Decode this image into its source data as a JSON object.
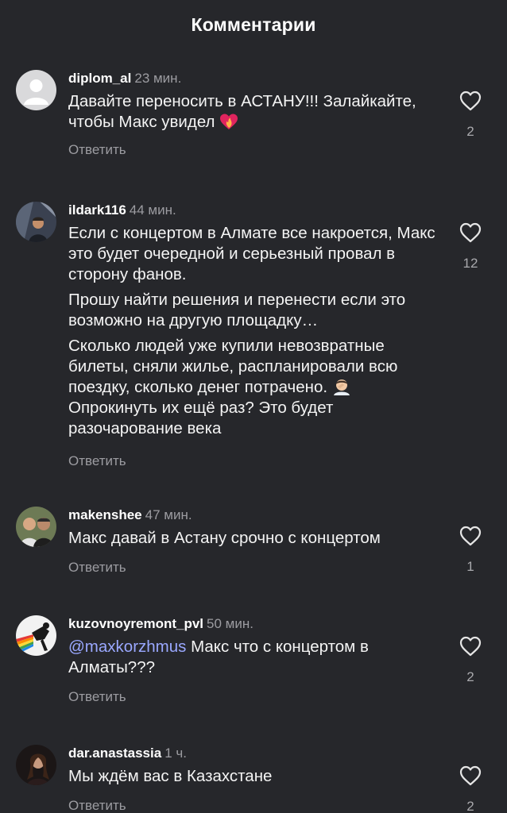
{
  "header": {
    "title": "Комментарии"
  },
  "colors": {
    "background": "#26272b",
    "text": "#f2f2f2",
    "muted": "#9c9ca1",
    "mention": "#9aa8ff"
  },
  "comments": [
    {
      "username": "diplom_al",
      "time": "23 мин.",
      "paragraphs": [
        "Давайте переносить в АСТАНУ!!! Залайкайте, чтобы Макс увидел"
      ],
      "likes": "2",
      "reply_label": "Ответить",
      "avatar": "default-avatar-icon",
      "emoji": "heart-on-fire-emoji"
    },
    {
      "username": "ildark116",
      "time": "44 мин.",
      "paragraphs": [
        "Если с концертом в Алмате все накроется, Макс это будет очередной и серьезный провал в сторону фанов.",
        "Прошу найти решения и перенести если это возможно на другую площадку…",
        "Сколько людей уже купили невозвратные билеты, сняли жилье, распланировали всю поездку, сколько денег потрачено.",
        "Опрокинуть их ещё раз? Это будет разочарование века"
      ],
      "likes": "12",
      "reply_label": "Ответить",
      "avatar": "user-photo-avatar",
      "emoji": "facepalm-emoji"
    },
    {
      "username": "makenshee",
      "time": "47 мин.",
      "paragraphs": [
        "Макс давай в Астану срочно с концертом"
      ],
      "likes": "1",
      "reply_label": "Ответить",
      "avatar": "user-photo-avatar"
    },
    {
      "username": "kuzovnoyremont_pvl",
      "time": "50 мин.",
      "mention": "@maxkorzhmus",
      "paragraphs": [
        " Макс что с концертом в Алматы???"
      ],
      "likes": "2",
      "reply_label": "Ответить",
      "avatar": "logo-avatar"
    },
    {
      "username": "dar.anastassia",
      "time": "1 ч.",
      "paragraphs": [
        "Мы ждём вас в Казахстане"
      ],
      "likes": "2",
      "reply_label": "Ответить",
      "avatar": "user-photo-avatar"
    }
  ]
}
